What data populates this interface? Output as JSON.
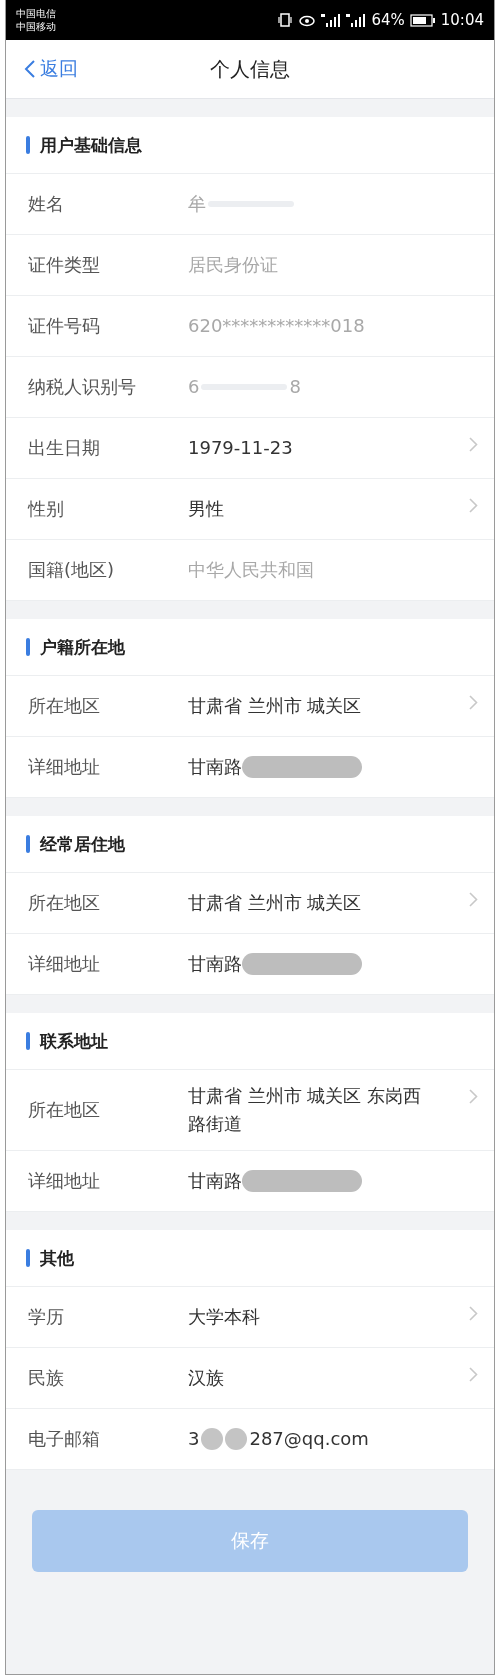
{
  "status_bar": {
    "carriers": [
      "中国电信",
      "中国移动"
    ],
    "battery_text": "64%",
    "time": "10:04"
  },
  "nav": {
    "back": "返回",
    "title": "个人信息"
  },
  "sections": [
    {
      "title": "用户基础信息",
      "rows": [
        {
          "label": "姓名",
          "muted": true,
          "arrow": false,
          "parts": [
            {
              "kind": "text",
              "text": "牟"
            },
            {
              "kind": "blur"
            }
          ]
        },
        {
          "label": "证件类型",
          "muted": true,
          "arrow": false,
          "parts": [
            {
              "kind": "text",
              "text": "居民身份证"
            }
          ]
        },
        {
          "label": "证件号码",
          "muted": true,
          "arrow": false,
          "parts": [
            {
              "kind": "text",
              "text": "620************018"
            }
          ]
        },
        {
          "label": "纳税人识别号",
          "muted": true,
          "arrow": false,
          "parts": [
            {
              "kind": "text",
              "text": "6"
            },
            {
              "kind": "blur"
            },
            {
              "kind": "text",
              "text": "8"
            }
          ]
        },
        {
          "label": "出生日期",
          "muted": false,
          "arrow": true,
          "parts": [
            {
              "kind": "text",
              "text": "1979-11-23"
            }
          ]
        },
        {
          "label": "性别",
          "muted": false,
          "arrow": true,
          "parts": [
            {
              "kind": "text",
              "text": "男性"
            }
          ]
        },
        {
          "label": "国籍(地区)",
          "muted": true,
          "arrow": false,
          "parts": [
            {
              "kind": "text",
              "text": "中华人民共和国"
            }
          ]
        }
      ]
    },
    {
      "title": "户籍所在地",
      "rows": [
        {
          "label": "所在地区",
          "muted": false,
          "arrow": true,
          "parts": [
            {
              "kind": "text",
              "text": "甘肃省 兰州市 城关区"
            }
          ]
        },
        {
          "label": "详细地址",
          "muted": false,
          "arrow": false,
          "parts": [
            {
              "kind": "text",
              "text": "甘南路"
            },
            {
              "kind": "pill"
            }
          ]
        }
      ]
    },
    {
      "title": "经常居住地",
      "rows": [
        {
          "label": "所在地区",
          "muted": false,
          "arrow": true,
          "parts": [
            {
              "kind": "text",
              "text": "甘肃省 兰州市 城关区"
            }
          ]
        },
        {
          "label": "详细地址",
          "muted": false,
          "arrow": false,
          "parts": [
            {
              "kind": "text",
              "text": "甘南路"
            },
            {
              "kind": "pill"
            }
          ]
        }
      ]
    },
    {
      "title": "联系地址",
      "rows": [
        {
          "label": "所在地区",
          "muted": false,
          "arrow": true,
          "parts": [
            {
              "kind": "text",
              "text": "甘肃省 兰州市 城关区 东岗西路街道"
            }
          ]
        },
        {
          "label": "详细地址",
          "muted": false,
          "arrow": false,
          "parts": [
            {
              "kind": "text",
              "text": "甘南路"
            },
            {
              "kind": "pill"
            }
          ]
        }
      ]
    },
    {
      "title": "其他",
      "rows": [
        {
          "label": "学历",
          "muted": false,
          "arrow": true,
          "parts": [
            {
              "kind": "text",
              "text": "大学本科"
            }
          ]
        },
        {
          "label": "民族",
          "muted": false,
          "arrow": true,
          "parts": [
            {
              "kind": "text",
              "text": "汉族"
            }
          ]
        },
        {
          "label": "电子邮箱",
          "muted": false,
          "arrow": false,
          "parts": [
            {
              "kind": "text",
              "text": "3"
            },
            {
              "kind": "dots"
            },
            {
              "kind": "text",
              "text": "287@qq.com"
            }
          ]
        }
      ]
    }
  ],
  "save_button": {
    "label": "保存",
    "disabled": true
  }
}
